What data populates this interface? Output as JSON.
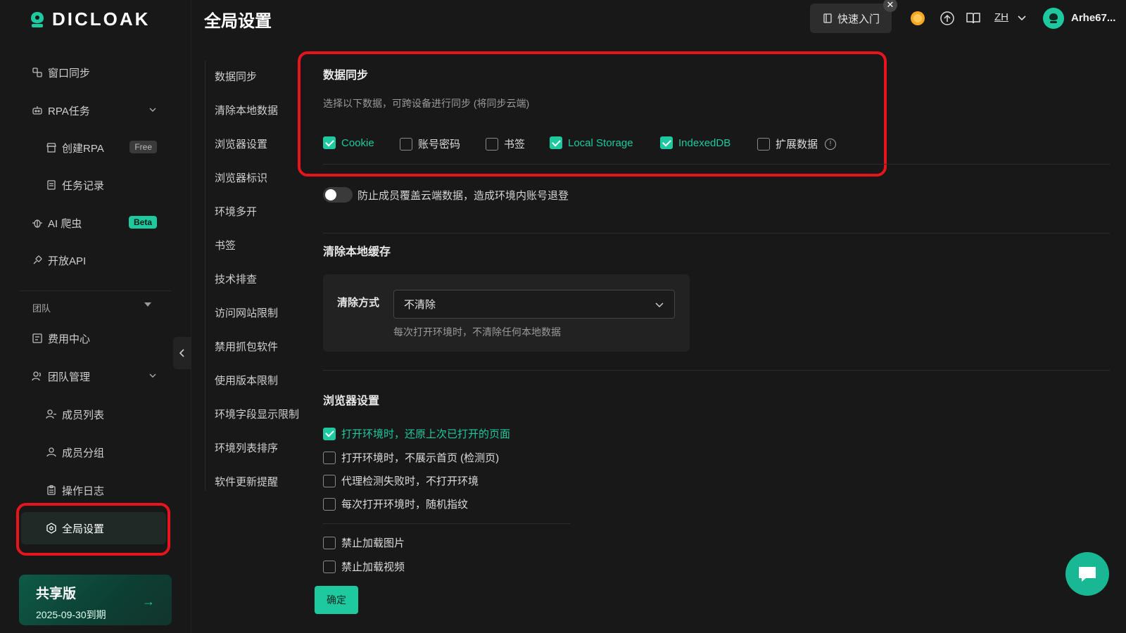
{
  "app": {
    "logo_text": "DICLOAK",
    "page_title": "全局设置"
  },
  "topbar": {
    "quick_start_label": "快速入门",
    "close_glyph": "✕",
    "lang": "ZH",
    "username": "Arhe67..."
  },
  "sidebar": {
    "items": [
      {
        "label": "窗口同步"
      },
      {
        "label": "RPA任务"
      },
      {
        "label": "创建RPA",
        "badge": "Free"
      },
      {
        "label": "任务记录"
      },
      {
        "label": "AI 爬虫",
        "badge": "Beta"
      },
      {
        "label": "开放API"
      }
    ],
    "team_label": "团队",
    "team_items": [
      {
        "label": "费用中心"
      },
      {
        "label": "团队管理"
      },
      {
        "label": "成员列表"
      },
      {
        "label": "成员分组"
      },
      {
        "label": "操作日志"
      },
      {
        "label": "全局设置"
      }
    ],
    "plan": {
      "title": "共享版",
      "expiry": "2025-09-30到期"
    }
  },
  "submenu": {
    "items": [
      "数据同步",
      "清除本地数据",
      "浏览器设置",
      "浏览器标识",
      "环境多开",
      "书签",
      "技术排查",
      "访问网站限制",
      "禁用抓包软件",
      "使用版本限制",
      "环境字段显示限制",
      "环境列表排序",
      "软件更新提醒"
    ]
  },
  "data_sync": {
    "title": "数据同步",
    "description": "选择以下数据，可跨设备进行同步 (将同步云端)",
    "options": [
      {
        "label": "Cookie",
        "checked": true
      },
      {
        "label": "账号密码",
        "checked": false
      },
      {
        "label": "书签",
        "checked": false
      },
      {
        "label": "Local Storage",
        "checked": true
      },
      {
        "label": "IndexedDB",
        "checked": true
      },
      {
        "label": "扩展数据",
        "checked": false
      }
    ],
    "toggle_label": "防止成员覆盖云端数据，造成环境内账号退登",
    "toggle_on": false
  },
  "clear_cache": {
    "title": "清除本地缓存",
    "method_label": "清除方式",
    "selected": "不清除",
    "hint": "每次打开环境时，不清除任何本地数据"
  },
  "browser_settings": {
    "title": "浏览器设置",
    "options": [
      {
        "label": "打开环境时，还原上次已打开的页面",
        "checked": true
      },
      {
        "label": "打开环境时，不展示首页 (检测页)",
        "checked": false
      },
      {
        "label": "代理检测失败时，不打开环境",
        "checked": false
      },
      {
        "label": "每次打开环境时，随机指纹",
        "checked": false
      },
      {
        "label": "禁止加载图片",
        "checked": false
      },
      {
        "label": "禁止加载视频",
        "checked": false
      }
    ]
  },
  "actions": {
    "confirm_label": "确定"
  },
  "colors": {
    "accent": "#1ec9a0",
    "highlight_border": "#e8141c",
    "background": "#181818"
  }
}
